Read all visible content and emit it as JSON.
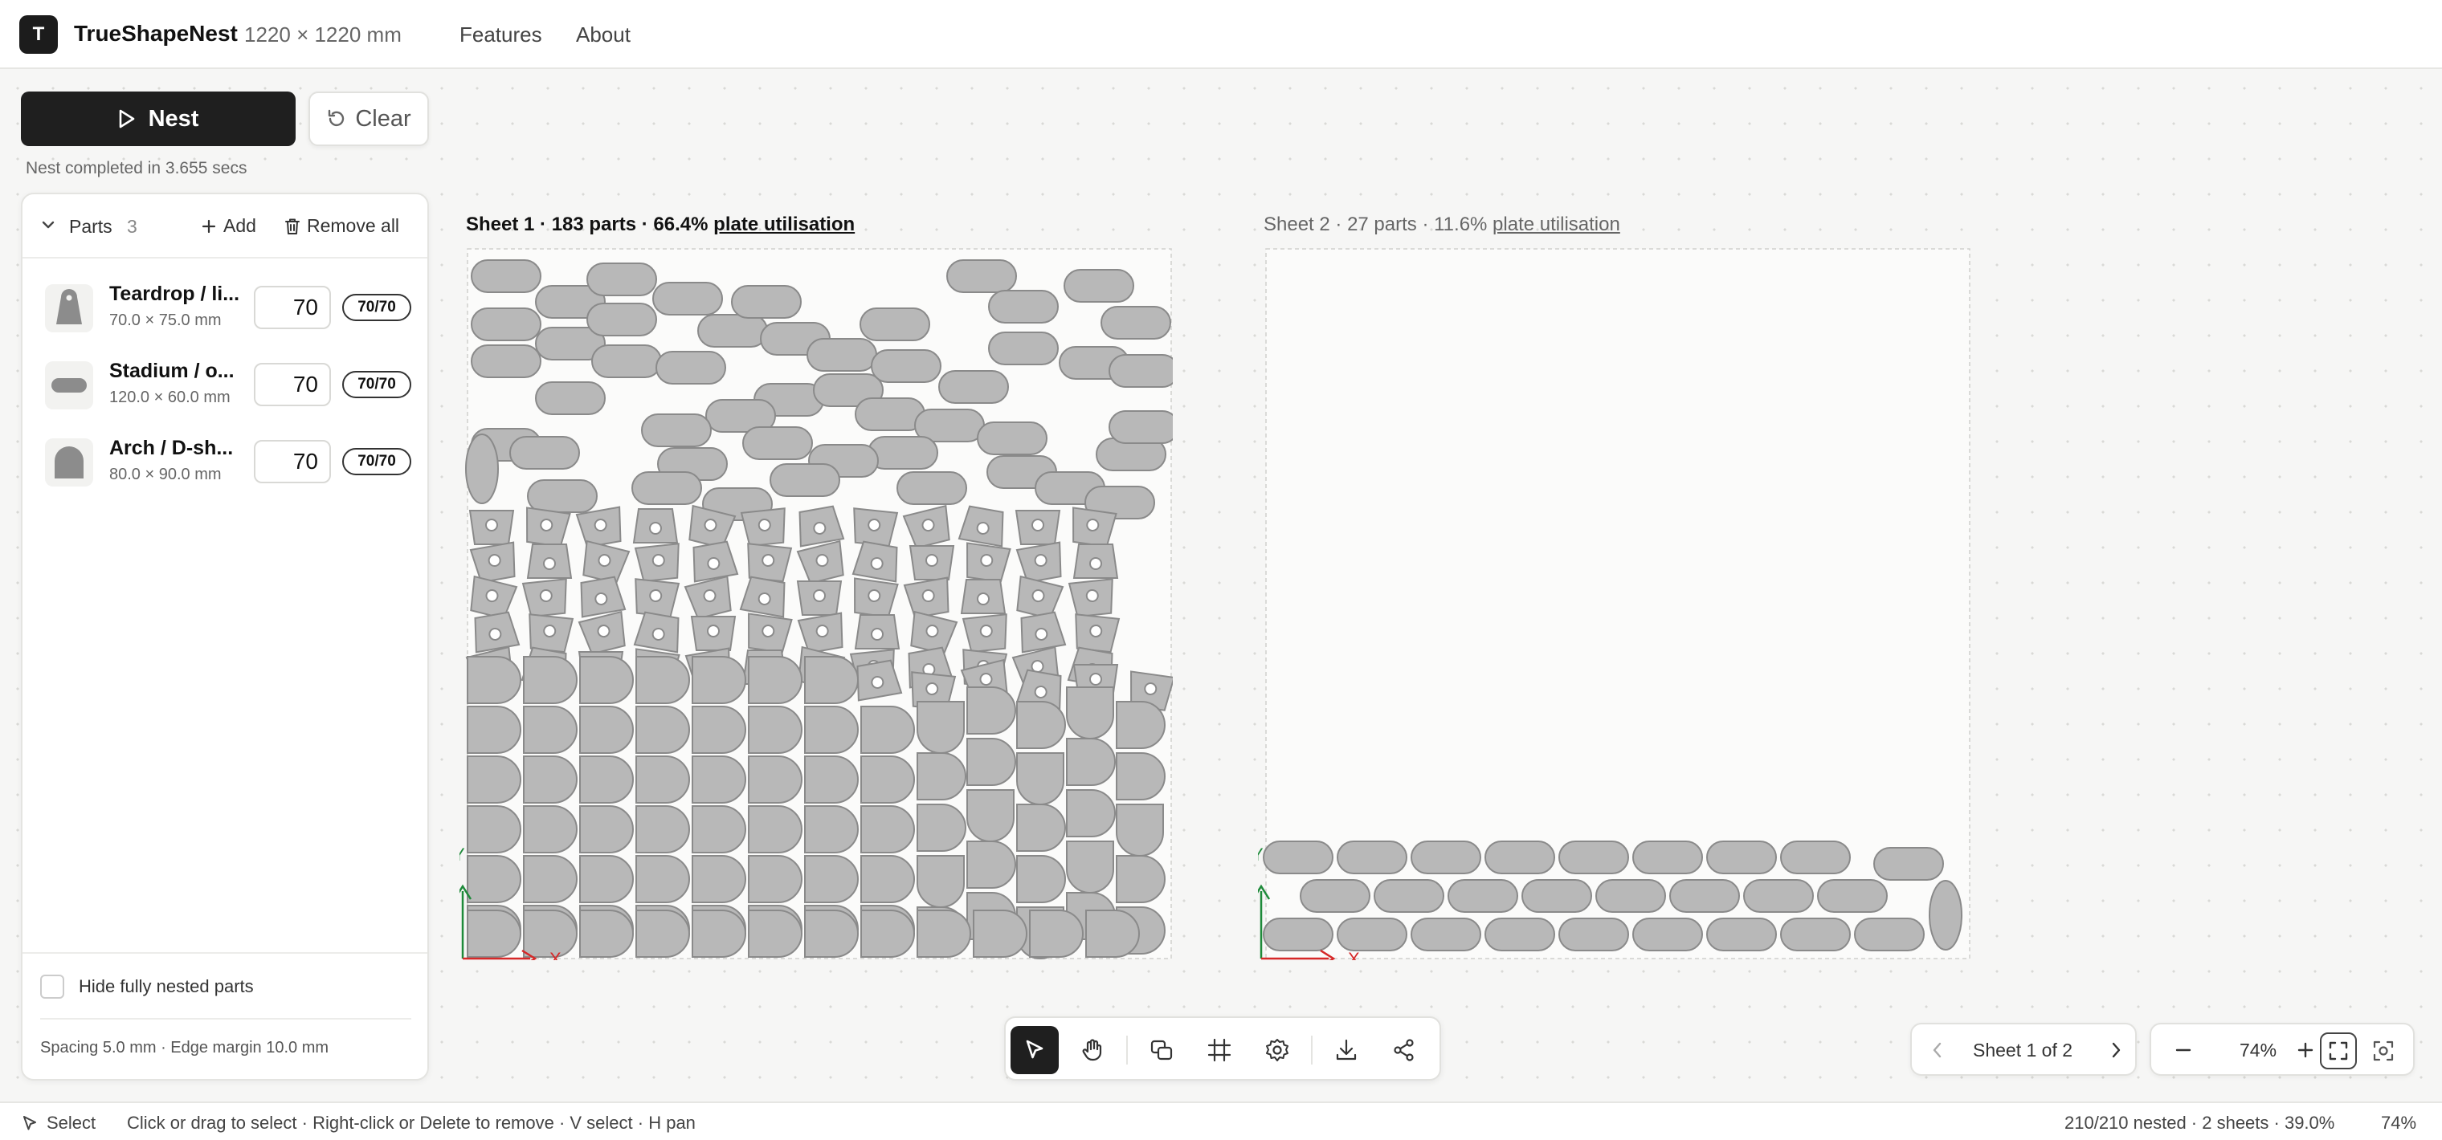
{
  "header": {
    "logo_letter": "T",
    "app_name": "TrueShapeNest",
    "sheet_size": "1220 × 1220 mm",
    "nav": [
      "Features",
      "About"
    ]
  },
  "actions": {
    "nest_label": "Nest",
    "clear_label": "Clear",
    "status": "Nest completed in 3.655 secs"
  },
  "parts_panel": {
    "title": "Parts",
    "count": "3",
    "add_label": "Add",
    "remove_all_label": "Remove all",
    "items": [
      {
        "name": "Teardrop / li...",
        "dims": "70.0 × 75.0 mm",
        "qty": "70",
        "badge": "70/70",
        "icon": "teardrop-icon"
      },
      {
        "name": "Stadium / o...",
        "dims": "120.0 × 60.0 mm",
        "qty": "70",
        "badge": "70/70",
        "icon": "stadium-icon"
      },
      {
        "name": "Arch / D-sh...",
        "dims": "80.0 × 90.0 mm",
        "qty": "70",
        "badge": "70/70",
        "icon": "arch-icon"
      }
    ],
    "hide_label": "Hide fully nested parts",
    "hide_checked": false,
    "spacing": "Spacing 5.0 mm · Edge margin 10.0 mm"
  },
  "sheets": [
    {
      "label": "Sheet 1 · 183 parts · 66.4% ",
      "link": "plate utilisation",
      "active": true
    },
    {
      "label": "Sheet 2 · 27 parts · 11.6% ",
      "link": "plate utilisation",
      "active": false
    }
  ],
  "axes": {
    "x": "X",
    "y": "Y",
    "x_color": "#d62828",
    "y_color": "#1e8a3a"
  },
  "colors": {
    "part_fill": "#b8b8b8",
    "part_stroke": "#8a8a8a",
    "accent": "#1f1f1f"
  },
  "toolbar": {
    "tools": [
      "select-tool-icon",
      "pan-tool-icon",
      "overlap-icon",
      "grid-icon",
      "settings-icon",
      "download-icon",
      "share-icon"
    ],
    "active": "select-tool-icon"
  },
  "pager": {
    "text": "Sheet 1 of 2"
  },
  "zoom": {
    "value": "74%"
  },
  "statusbar": {
    "mode": "Select",
    "hint": "Click or drag to select · Right-click or Delete to remove · V select · H pan",
    "summary": "210/210 nested · 2 sheets · 39.0%",
    "zoom": "74%"
  }
}
